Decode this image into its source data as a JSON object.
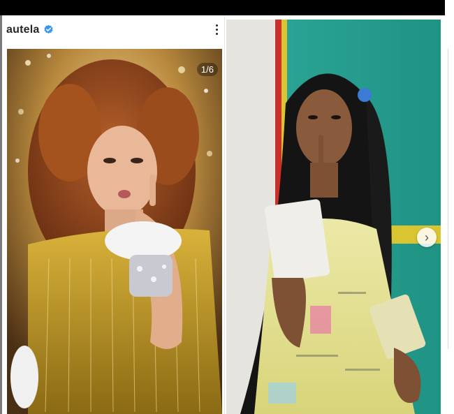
{
  "post": {
    "username": "autela",
    "verified_icon": "verified-badge-icon",
    "more_icon": "more-options-icon",
    "image_counter": "1/6"
  },
  "carousel": {
    "next_icon": "chevron-right-icon",
    "next_symbol": "›"
  },
  "colors": {
    "verified_blue": "#3897f0",
    "topbar": "#000000",
    "teal_wall": "#2ea89a",
    "red_trim": "#c9302c"
  }
}
